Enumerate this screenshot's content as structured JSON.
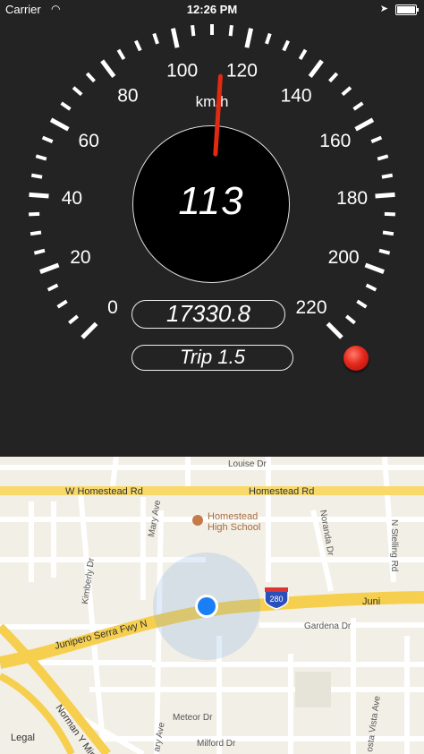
{
  "status_bar": {
    "carrier": "Carrier",
    "time": "12:26 PM",
    "battery_level": 1.0
  },
  "speedometer": {
    "unit": "km/h",
    "speed": "113",
    "odometer": "17330.8",
    "trip": "Trip 1.5",
    "scale_labels": [
      "0",
      "20",
      "40",
      "60",
      "80",
      "100",
      "120",
      "140",
      "160",
      "180",
      "200",
      "220"
    ],
    "needle_value": 113,
    "max_value": 220,
    "needle_color": "#e02a12"
  },
  "map": {
    "streets": {
      "louise_dr": "Louise Dr",
      "w_homestead_rd": "W Homestead Rd",
      "homestead_rd": "Homestead Rd",
      "mary_ave": "Mary Ave",
      "noranda_dr": "Noranda Dr",
      "n_stelling_rd": "N Stelling Rd",
      "kimberly_dr": "Kimberly Dr",
      "junipero_serra_fwy": "Junipero Serra Fwy N",
      "juni": "Juni",
      "gardena_dr": "Gardena Dr",
      "meteor_dr": "Meteor Dr",
      "milford_dr": "Milford Dr",
      "norman_y_mineta": "Norman Y Mineta",
      "costa_vista": "osta Vista Ave",
      "arg": "ary Ave"
    },
    "poi": "Homestead High School",
    "interstate": "280",
    "legal": "Legal",
    "location_color": "#1a7ff5"
  }
}
